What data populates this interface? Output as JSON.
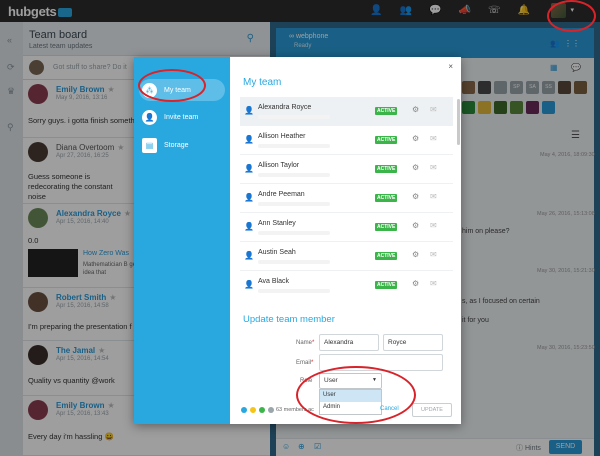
{
  "app": {
    "logo": "hubgets"
  },
  "topbar": {
    "icons": [
      "add-user-icon",
      "team-icon",
      "chat-icon",
      "megaphone-icon",
      "phone-icon",
      "bell-icon"
    ]
  },
  "left_panel": {
    "title": "Team board",
    "subtitle": "Latest team updates",
    "share_placeholder": "Got stuff to share? Do it",
    "posts": [
      {
        "name": "Emily Brown",
        "date": "May 9, 2016, 13:16",
        "text": "Sorry guys. i gotta finish someth"
      },
      {
        "name": "Diana Overtoom",
        "date": "Apr 27, 2016, 16:25",
        "text": "Guess someone is redecorating the constant noise"
      },
      {
        "name": "Alexandra Royce",
        "date": "Apr 15, 2016, 14:40",
        "text": "0.0",
        "link_title": "How Zero Was",
        "link_desc": "Mathematician B genius idea that"
      },
      {
        "name": "Robert Smith",
        "date": "Apr 15, 2016, 14:58",
        "text": "I'm preparing the presentation f"
      },
      {
        "name": "The Jamal",
        "date": "Apr 15, 2016, 14:54",
        "text": "Quality vs quantity @work"
      },
      {
        "name": "Emily Brown",
        "date": "Apr 15, 2016, 13:43",
        "text": "Every day i'm hassling 😀"
      }
    ]
  },
  "right_panel": {
    "title": "webphone",
    "status": "Ready",
    "tiles": [
      "SP",
      "SA",
      "SS"
    ],
    "messages": [
      {
        "date": "May 4, 2016, 18:09:30"
      },
      {
        "date": "May 26, 2016, 15:13:08",
        "text": "him on please?"
      },
      {
        "date": "May 30, 2016, 15:21:30",
        "text": "s, as I focused on certain",
        "text2": "it for you"
      },
      {
        "date": "May 30, 2016, 15:23:50"
      }
    ],
    "hints": "Hints",
    "send": "SEND"
  },
  "modal": {
    "nav": [
      {
        "label": "My team",
        "icon": "team-icon"
      },
      {
        "label": "Invite team",
        "icon": "add-user-icon"
      },
      {
        "label": "Storage",
        "icon": "storage-icon"
      }
    ],
    "title": "My team",
    "members": [
      {
        "name": "Alexandra Royce",
        "status": "ACTIVE"
      },
      {
        "name": "Allison Heather",
        "status": "ACTIVE"
      },
      {
        "name": "Allison Taylor",
        "status": "ACTIVE"
      },
      {
        "name": "Andre Peeman",
        "status": "ACTIVE"
      },
      {
        "name": "Ann Stanley",
        "status": "ACTIVE"
      },
      {
        "name": "Austin Seah",
        "status": "ACTIVE"
      },
      {
        "name": "Ava Black",
        "status": "ACTIVE"
      }
    ],
    "update_title": "Update team member",
    "form": {
      "name_label": "Name",
      "first_name": "Alexandra",
      "last_name": "Royce",
      "email_label": "Email",
      "role_label": "Role",
      "role_value": "User",
      "role_options": [
        "User",
        "Admin"
      ]
    },
    "members_count": "63 members ac",
    "cancel": "Cancel",
    "update": "UPDATE",
    "close": "×"
  }
}
